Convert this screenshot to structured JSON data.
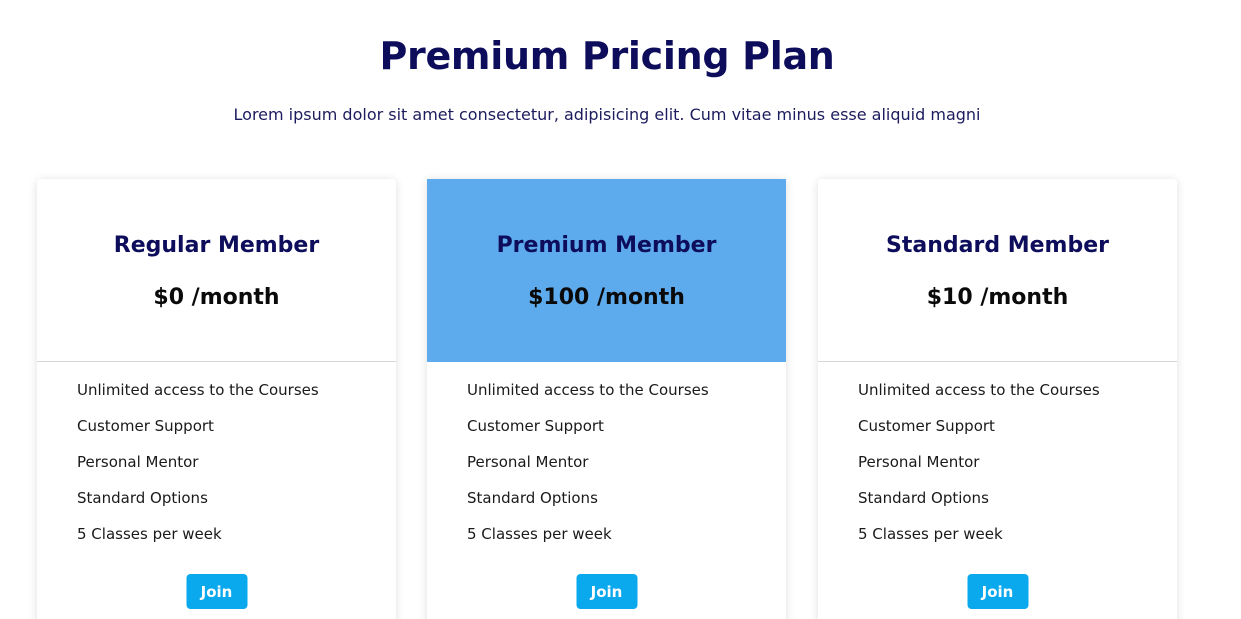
{
  "header": {
    "title": "Premium Pricing Plan",
    "subtitle": "Lorem ipsum dolor sit amet consectetur, adipisicing elit. Cum vitae minus esse aliquid magni"
  },
  "plans": [
    {
      "name": "Regular Member",
      "price": "$0 /month",
      "features": [
        "Unlimited access to the Courses",
        "Customer Support",
        "Personal Mentor",
        "Standard Options",
        "5 Classes per week"
      ],
      "button_label": "Join"
    },
    {
      "name": "Premium Member",
      "price": "$100 /month",
      "features": [
        "Unlimited access to the Courses",
        "Customer Support",
        "Personal Mentor",
        "Standard Options",
        "5 Classes per week"
      ],
      "button_label": "Join"
    },
    {
      "name": "Standard Member",
      "price": "$10 /month",
      "features": [
        "Unlimited access to the Courses",
        "Customer Support",
        "Personal Mentor",
        "Standard Options",
        "5 Classes per week"
      ],
      "button_label": "Join"
    }
  ],
  "colors": {
    "heading": "#0d0d5c",
    "featured_header": "#5dabec",
    "button": "#0aa8ec"
  }
}
